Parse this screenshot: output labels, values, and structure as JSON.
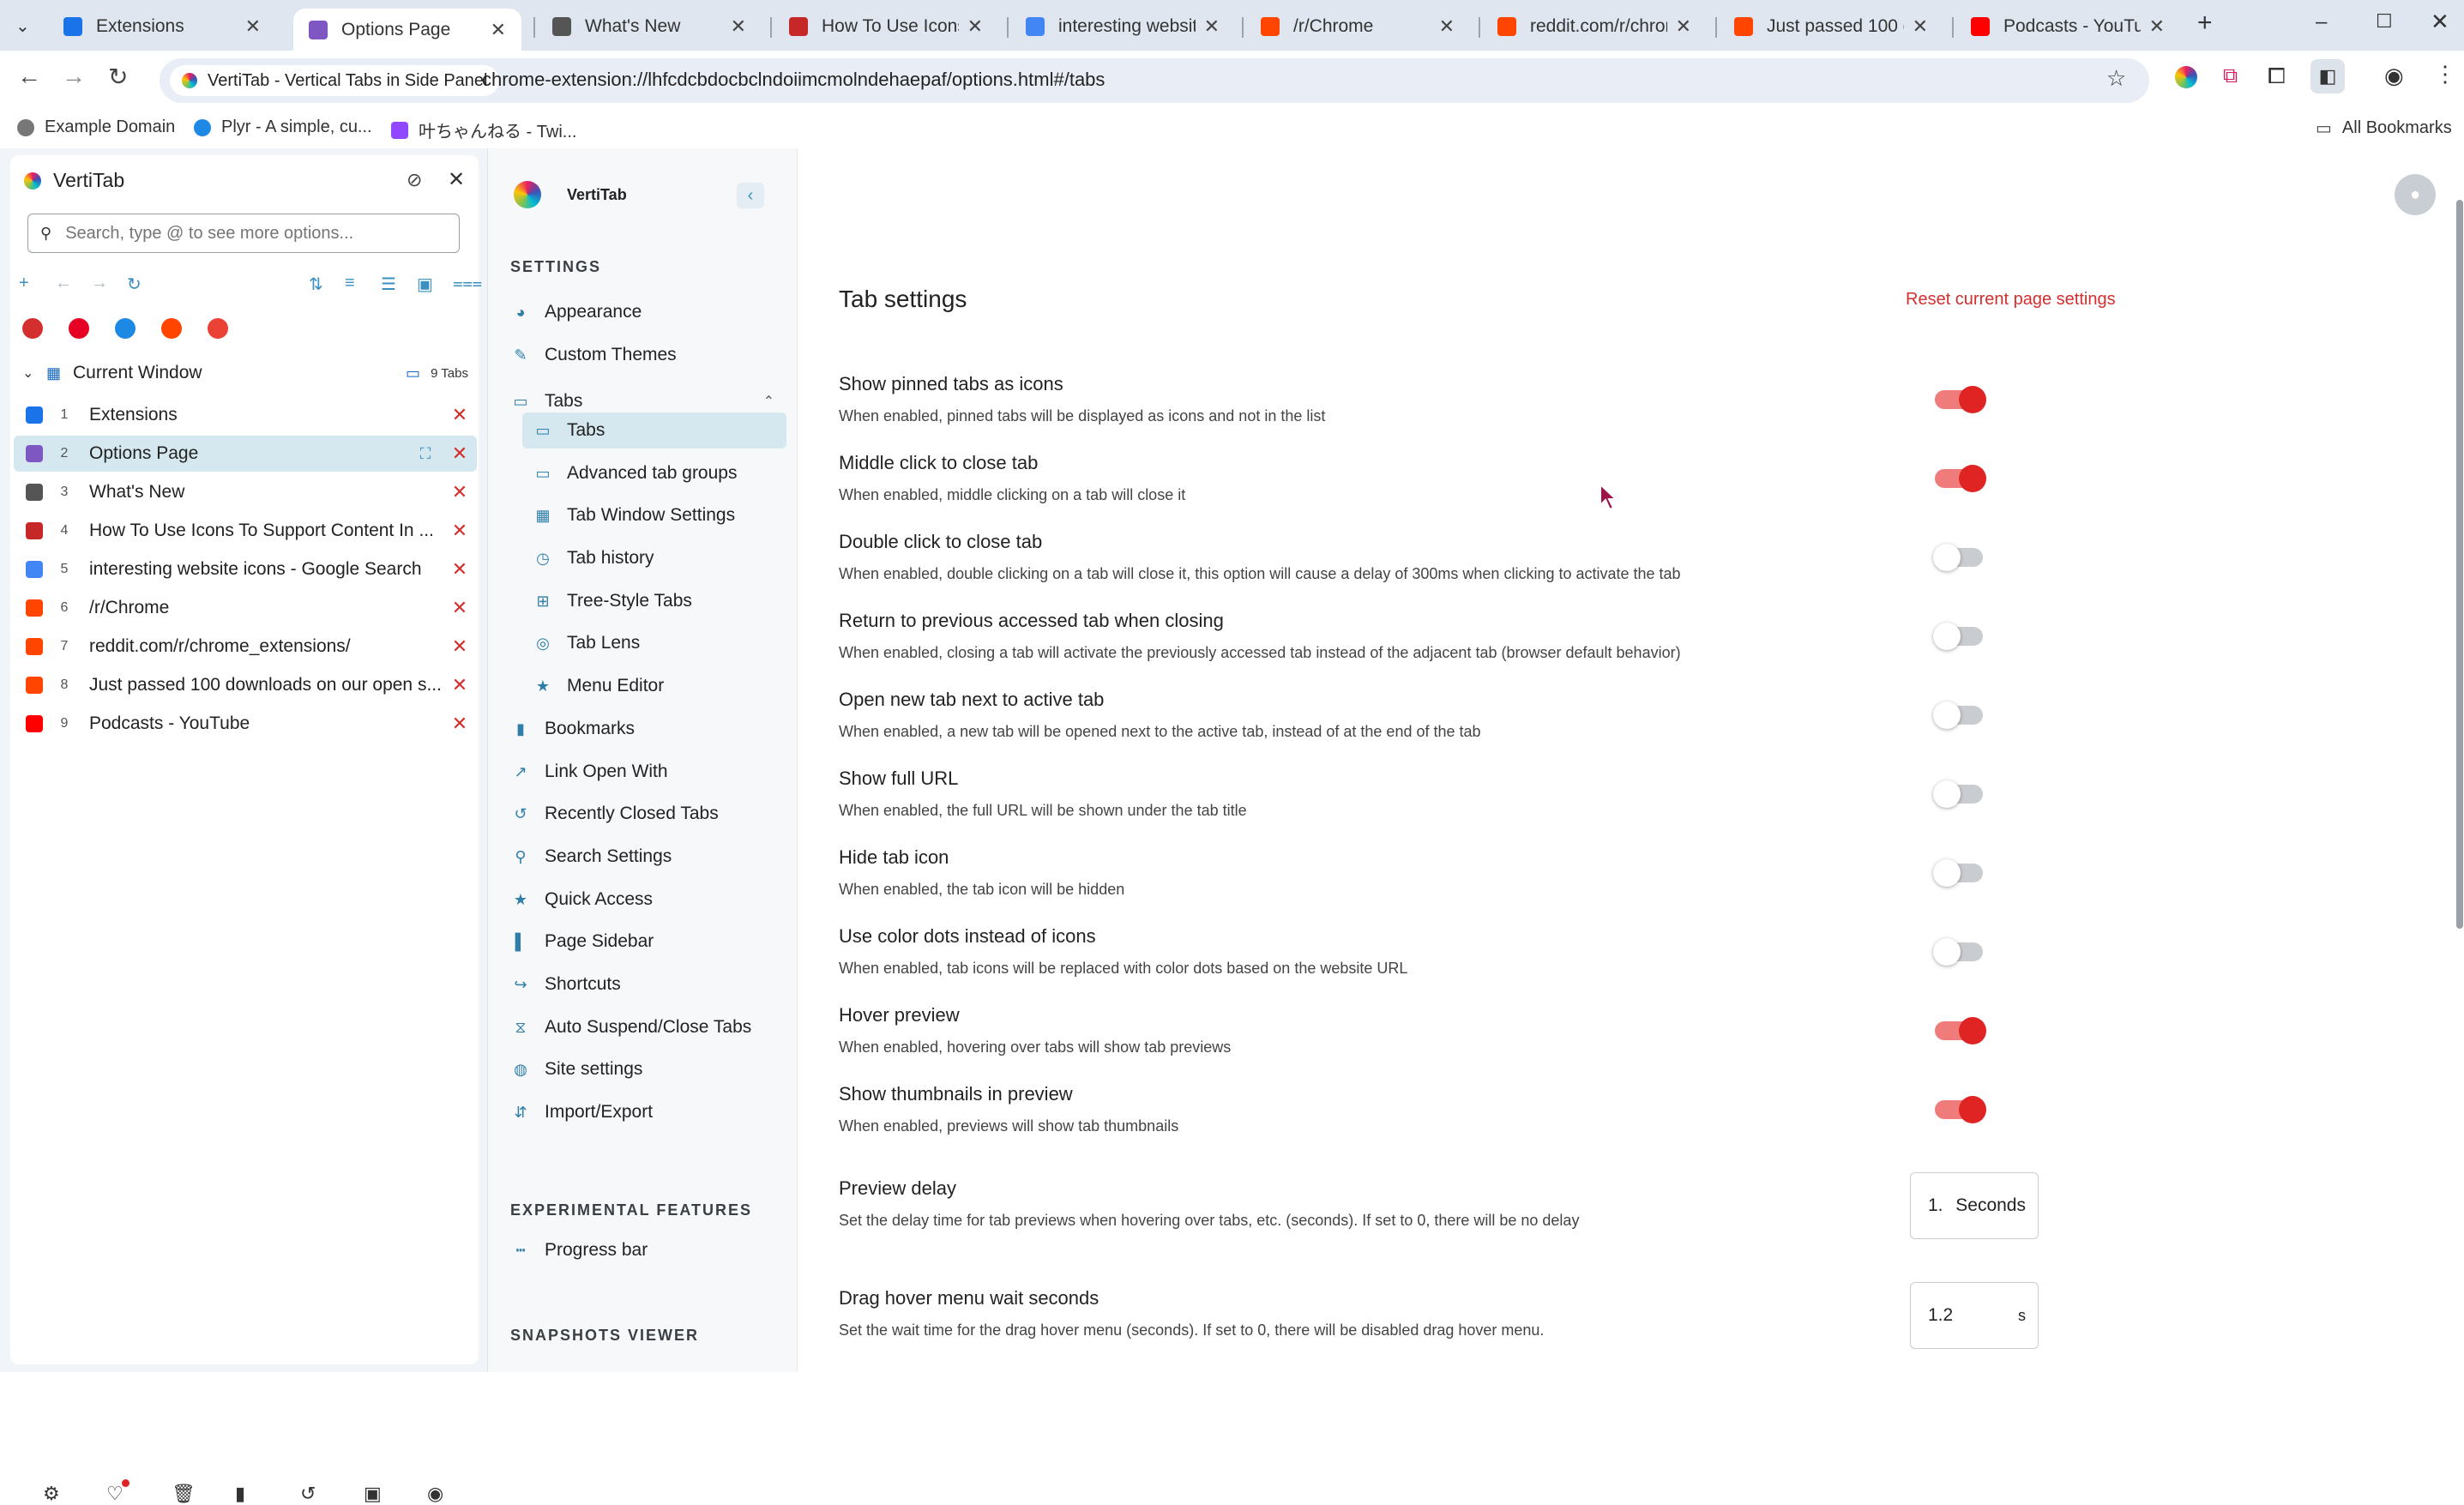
{
  "tabs": [
    {
      "title": "Extensions",
      "icon": "puzzle-icon",
      "color": "#1a73e8"
    },
    {
      "title": "Options Page",
      "icon": "vertitab-logo-icon",
      "color": "#7e57c2"
    },
    {
      "title": "What's New",
      "icon": "chrome-icon",
      "color": "#555555"
    },
    {
      "title": "How To Use Icons To",
      "icon": "site-icon",
      "color": "#c62828"
    },
    {
      "title": "interesting website",
      "icon": "google-icon",
      "color": "#4285f4"
    },
    {
      "title": "/r/Chrome",
      "icon": "reddit-icon",
      "color": "#ff4500"
    },
    {
      "title": "reddit.com/r/chrom",
      "icon": "reddit-icon",
      "color": "#ff4500"
    },
    {
      "title": "Just passed 100 do",
      "icon": "reddit-icon",
      "color": "#ff4500"
    },
    {
      "title": "Podcasts - YouTube",
      "icon": "youtube-icon",
      "color": "#ff0000"
    }
  ],
  "omnibox": {
    "chip": "VertiTab - Vertical Tabs in Side Panel",
    "url": "chrome-extension://lhfcdcbdocbclndoiimcmolndehaepaf/options.html#/tabs"
  },
  "bookmarks": {
    "items": [
      "Example Domain",
      "Plyr - A simple, cu...",
      "叶ちゃんねる - Twi..."
    ],
    "all": "All Bookmarks"
  },
  "sidepanel": {
    "title": "VertiTab",
    "search_placeholder": "Search, type @ to see more options...",
    "window_label": "Current Window",
    "tab_count": "9 Tabs",
    "items": [
      {
        "n": "1",
        "title": "Extensions",
        "color": "#1a73e8"
      },
      {
        "n": "2",
        "title": "Options Page",
        "color": "#7e57c2"
      },
      {
        "n": "3",
        "title": "What's New",
        "color": "#555555"
      },
      {
        "n": "4",
        "title": "How To Use Icons To Support Content In ...",
        "color": "#c62828"
      },
      {
        "n": "5",
        "title": "interesting website icons - Google Search",
        "color": "#4285f4"
      },
      {
        "n": "6",
        "title": "/r/Chrome",
        "color": "#ff4500"
      },
      {
        "n": "7",
        "title": "reddit.com/r/chrome_extensions/",
        "color": "#ff4500"
      },
      {
        "n": "8",
        "title": "Just passed 100 downloads on our open s...",
        "color": "#ff4500"
      },
      {
        "n": "9",
        "title": "Podcasts - YouTube",
        "color": "#ff0000"
      }
    ],
    "pinned_colors": [
      "#d32f2f",
      "#e60023",
      "#1e88e5",
      "#ff4500",
      "#ea4335"
    ]
  },
  "options": {
    "brand": "VertiTab",
    "settings_heading": "SETTINGS",
    "nav": [
      {
        "label": "Appearance",
        "icon": "palette-icon",
        "sub": false
      },
      {
        "label": "Custom Themes",
        "icon": "brush-icon",
        "sub": false
      },
      {
        "label": "Tabs",
        "icon": "tabs-icon",
        "sub": false,
        "expanded": true
      },
      {
        "label": "Tabs",
        "icon": "tab-icon",
        "sub": true,
        "selected": true
      },
      {
        "label": "Advanced tab groups",
        "icon": "tab-groups-icon",
        "sub": true
      },
      {
        "label": "Tab Window Settings",
        "icon": "window-grid-icon",
        "sub": true
      },
      {
        "label": "Tab history",
        "icon": "clock-icon",
        "sub": true
      },
      {
        "label": "Tree-Style Tabs",
        "icon": "tree-icon",
        "sub": true
      },
      {
        "label": "Tab Lens",
        "icon": "lens-icon",
        "sub": true
      },
      {
        "label": "Menu Editor",
        "icon": "star-icon",
        "sub": true
      },
      {
        "label": "Bookmarks",
        "icon": "bookmark-icon",
        "sub": false
      },
      {
        "label": "Link Open With",
        "icon": "external-link-icon",
        "sub": false
      },
      {
        "label": "Recently Closed Tabs",
        "icon": "history-icon",
        "sub": false
      },
      {
        "label": "Search Settings",
        "icon": "search-icon",
        "sub": false
      },
      {
        "label": "Quick Access",
        "icon": "star-icon",
        "sub": false
      },
      {
        "label": "Page Sidebar",
        "icon": "sidebar-icon",
        "sub": false
      },
      {
        "label": "Shortcuts",
        "icon": "shortcut-icon",
        "sub": false
      },
      {
        "label": "Auto Suspend/Close Tabs",
        "icon": "suspend-icon",
        "sub": false
      },
      {
        "label": "Site settings",
        "icon": "globe-icon",
        "sub": false
      },
      {
        "label": "Import/Export",
        "icon": "import-export-icon",
        "sub": false
      }
    ],
    "experimental_heading": "EXPERIMENTAL FEATURES",
    "experimental": [
      {
        "label": "Progress bar",
        "icon": "progress-icon"
      }
    ],
    "snapshots_heading": "SNAPSHOTS VIEWER",
    "page_title": "Tab settings",
    "reset_label": "Reset current page settings",
    "settings": [
      {
        "title": "Show pinned tabs as icons",
        "desc": "When enabled, pinned tabs will be displayed as icons and not in the list",
        "on": true
      },
      {
        "title": "Middle click to close tab",
        "desc": "When enabled, middle clicking on a tab will close it",
        "on": true
      },
      {
        "title": "Double click to close tab",
        "desc": "When enabled, double clicking on a tab will close it, this option will cause a delay of 300ms when clicking to activate the tab",
        "on": false
      },
      {
        "title": "Return to previous accessed tab when closing",
        "desc": "When enabled, closing a tab will activate the previously accessed tab instead of the adjacent tab (browser default behavior)",
        "on": false
      },
      {
        "title": "Open new tab next to active tab",
        "desc": "When enabled, a new tab will be opened next to the active tab, instead of at the end of the tab",
        "on": false
      },
      {
        "title": "Show full URL",
        "desc": "When enabled, the full URL will be shown under the tab title",
        "on": false
      },
      {
        "title": "Hide tab icon",
        "desc": "When enabled, the tab icon will be hidden",
        "on": false
      },
      {
        "title": "Use color dots instead of icons",
        "desc": "When enabled, tab icons will be replaced with color dots based on the website URL",
        "on": false
      },
      {
        "title": "Hover preview",
        "desc": "When enabled, hovering over tabs will show tab previews",
        "on": true
      },
      {
        "title": "Show thumbnails in preview",
        "desc": "When enabled, previews will show tab thumbnails",
        "on": true
      }
    ],
    "preview_delay": {
      "title": "Preview delay",
      "desc": "Set the delay time for tab previews when hovering over tabs, etc. (seconds). If set to 0, there will be no delay",
      "value": "1.",
      "unit": "Seconds"
    },
    "drag_hover": {
      "title": "Drag hover menu wait seconds",
      "desc": "Set the wait time for the drag hover menu (seconds). If set to 0, there will be disabled drag hover menu.",
      "value": "1.2",
      "unit": "s"
    }
  },
  "colors": {
    "accent": "#e02424",
    "selected_bg": "#d5e8f0",
    "link": "#3a8fc0"
  }
}
